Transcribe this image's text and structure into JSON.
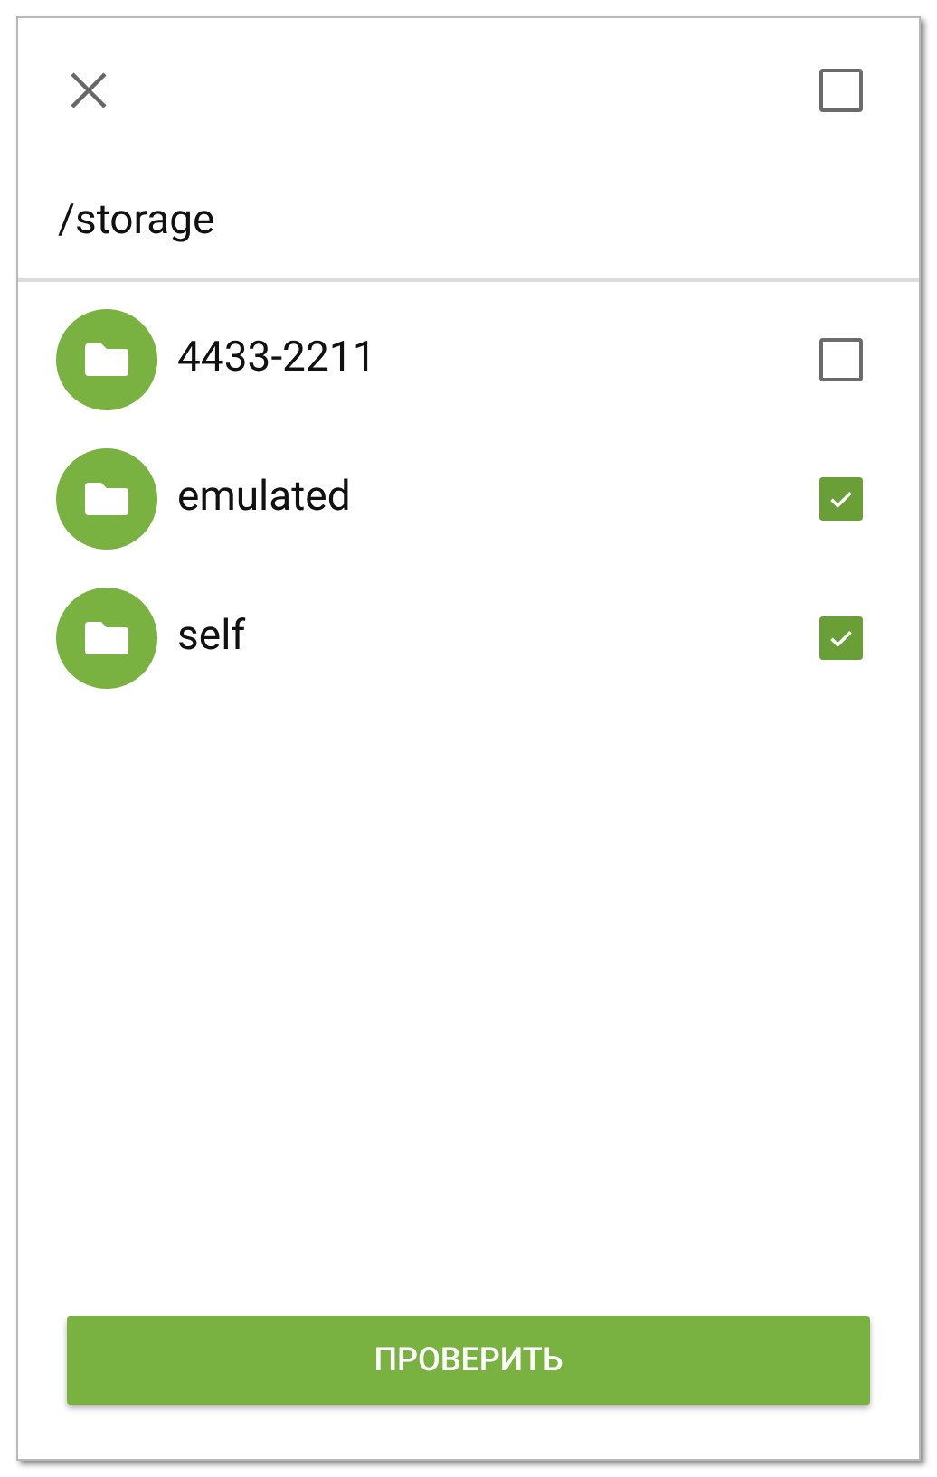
{
  "header": {
    "select_all_checked": false
  },
  "path": "/storage",
  "folders": [
    {
      "name": "4433-2211",
      "checked": false
    },
    {
      "name": "emulated",
      "checked": true
    },
    {
      "name": "self",
      "checked": true
    }
  ],
  "button": "ПРОВЕРИТЬ"
}
